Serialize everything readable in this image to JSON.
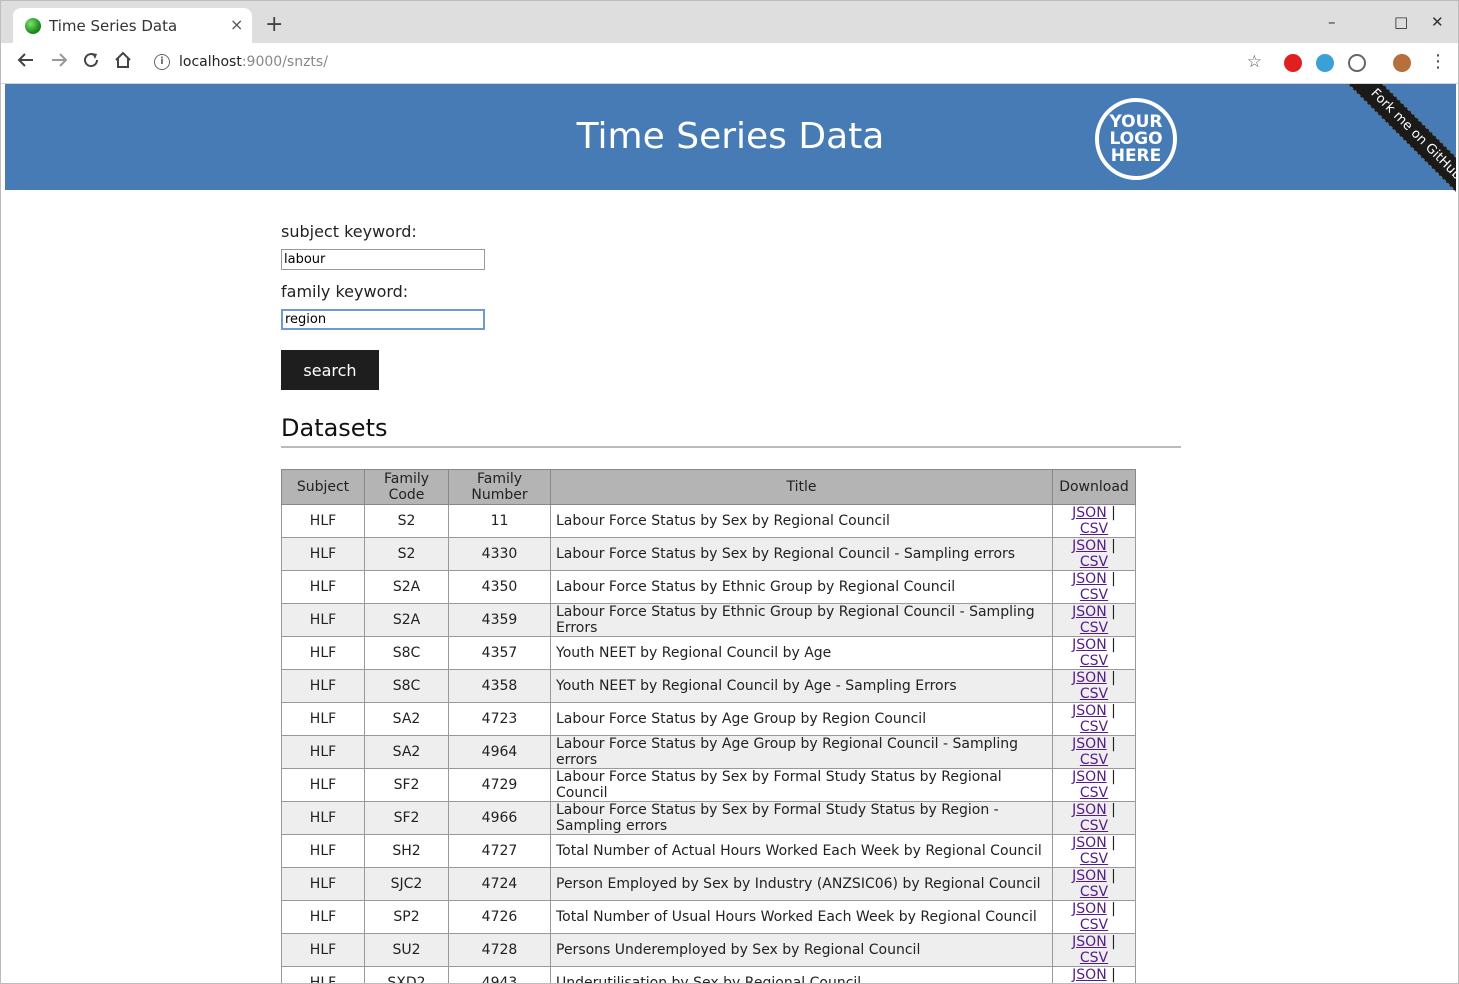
{
  "browser": {
    "tab_title": "Time Series Data",
    "tab_close": "×",
    "new_tab": "+",
    "url_host": "localhost",
    "url_rest": ":9000/snzts/",
    "minimize": "–",
    "maximize": "□",
    "close": "✕"
  },
  "header": {
    "title": "Time Series Data",
    "logo_text": "YOUR LOGO HERE",
    "ribbon": "Fork me on GitHub"
  },
  "form": {
    "subject_label": "subject keyword:",
    "subject_value": "labour",
    "family_label": "family keyword:",
    "family_value": "region",
    "search_label": "search"
  },
  "datasets": {
    "heading": "Datasets",
    "columns": [
      "Subject",
      "Family Code",
      "Family Number",
      "Title",
      "Download"
    ],
    "json_label": "JSON",
    "csv_label": "CSV",
    "separator": "|",
    "rows": [
      {
        "subject": "HLF",
        "code": "S2",
        "number": "11",
        "title": "Labour Force Status by Sex by Regional Council"
      },
      {
        "subject": "HLF",
        "code": "S2",
        "number": "4330",
        "title": "Labour Force Status by Sex by Regional Council - Sampling errors"
      },
      {
        "subject": "HLF",
        "code": "S2A",
        "number": "4350",
        "title": "Labour Force Status by Ethnic Group by Regional Council"
      },
      {
        "subject": "HLF",
        "code": "S2A",
        "number": "4359",
        "title": "Labour Force Status by Ethnic Group by Regional Council - Sampling Errors"
      },
      {
        "subject": "HLF",
        "code": "S8C",
        "number": "4357",
        "title": "Youth NEET by Regional Council by Age"
      },
      {
        "subject": "HLF",
        "code": "S8C",
        "number": "4358",
        "title": "Youth NEET by Regional Council by Age - Sampling Errors"
      },
      {
        "subject": "HLF",
        "code": "SA2",
        "number": "4723",
        "title": "Labour Force Status by Age Group by Region Council"
      },
      {
        "subject": "HLF",
        "code": "SA2",
        "number": "4964",
        "title": "Labour Force Status by Age Group by Regional Council - Sampling errors"
      },
      {
        "subject": "HLF",
        "code": "SF2",
        "number": "4729",
        "title": "Labour Force Status by Sex by Formal Study Status by Regional Council"
      },
      {
        "subject": "HLF",
        "code": "SF2",
        "number": "4966",
        "title": "Labour Force Status by Sex by Formal Study Status by Region - Sampling errors"
      },
      {
        "subject": "HLF",
        "code": "SH2",
        "number": "4727",
        "title": "Total Number of Actual Hours Worked Each Week by Regional Council"
      },
      {
        "subject": "HLF",
        "code": "SJC2",
        "number": "4724",
        "title": "Person Employed by Sex by Industry (ANZSIC06) by Regional Council"
      },
      {
        "subject": "HLF",
        "code": "SP2",
        "number": "4726",
        "title": "Total Number of Usual Hours Worked Each Week by Regional Council"
      },
      {
        "subject": "HLF",
        "code": "SU2",
        "number": "4728",
        "title": "Persons Underemployed by Sex by Regional Council"
      },
      {
        "subject": "HLF",
        "code": "SXD2",
        "number": "4943",
        "title": "Underutilisation by Sex by Regional Council"
      }
    ]
  }
}
